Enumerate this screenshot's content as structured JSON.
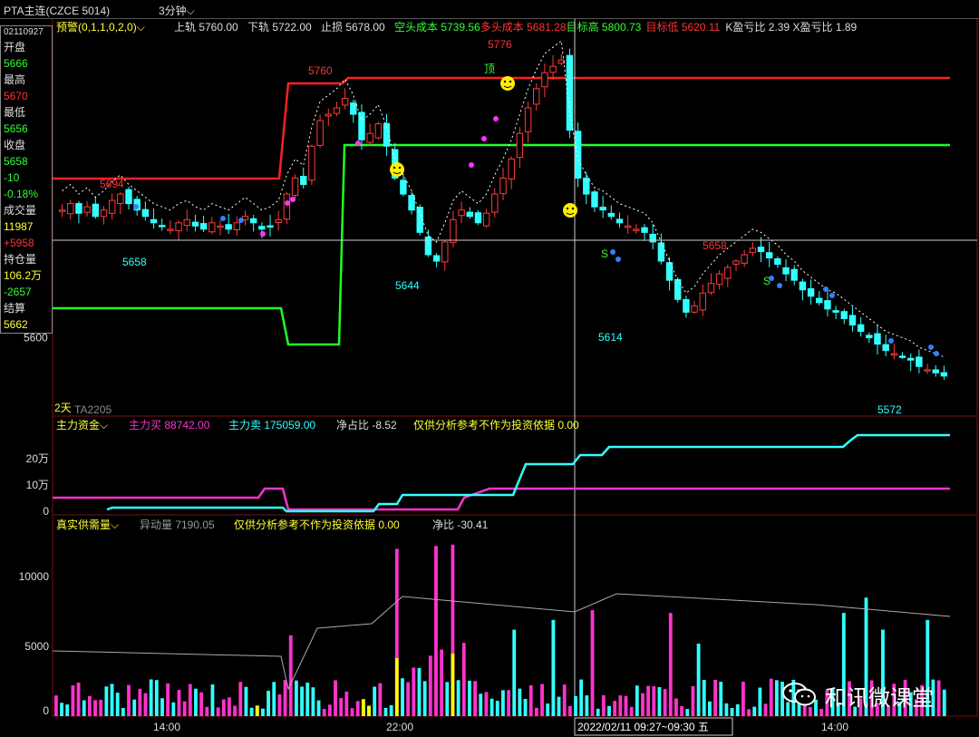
{
  "topbar": {
    "title": "PTA主连(CZCE 5014)",
    "period": "3分钟⌵"
  },
  "indicator_header": {
    "name": "预警(0,1,1,0,2,0)⌵",
    "items": [
      {
        "label": "上轨",
        "value": "5760.00",
        "color": "#dddddd"
      },
      {
        "label": "下轨",
        "value": "5722.00",
        "color": "#dddddd"
      },
      {
        "label": "止损",
        "value": "5678.00",
        "color": "#dddddd"
      },
      {
        "label": "空头成本",
        "value": "5739.56",
        "color": "#33ff33"
      },
      {
        "label": "多头成本",
        "value": "5681.28",
        "color": "#ff3333"
      },
      {
        "label": "目标高",
        "value": "5800.73",
        "color": "#33ff33"
      },
      {
        "label": "目标低",
        "value": "5620.11",
        "color": "#ff3333"
      },
      {
        "label": "K盈亏比",
        "value": "2.39",
        "color": "#dddddd"
      },
      {
        "label": "X盈亏比",
        "value": "1.89",
        "color": "#dddddd"
      }
    ]
  },
  "info_panel": {
    "date": "02110927",
    "open_label": "开盘",
    "open": "5666",
    "high_label": "最高",
    "high": "5670",
    "low_label": "最低",
    "low": "5656",
    "close_label": "收盘",
    "close": "5658",
    "change": "-10",
    "change_pct": "-0.18%",
    "volume_label": "成交量",
    "volume": "11987",
    "volume_change": "+5958",
    "oi_label": "持仓量",
    "oi": "106.2万",
    "oi_change": "-2657",
    "settle_label": "结算",
    "settle": "5662"
  },
  "main_annotations": {
    "range_label": "2天",
    "contract": "TA2205",
    "peak_labels": [
      "5694",
      "5760",
      "5776",
      "5658"
    ],
    "trough_labels": [
      "5658",
      "5644",
      "5614",
      "5572"
    ],
    "top_marker": "顶",
    "s_marker": "S"
  },
  "capital_header": {
    "name": "主力资金⌵",
    "buy_label": "主力买",
    "buy": "88742.00",
    "sell_label": "主力卖",
    "sell": "175059.00",
    "net_label": "净占比",
    "net": "-8.52",
    "note": "仅供分析参考不作为投资依据",
    "note_value": "0.00"
  },
  "volume_header": {
    "name": "真实供需量⌵",
    "abnormal_label": "异动量",
    "abnormal": "7190.05",
    "note": "仅供分析参考不作为投资依据",
    "note_value": "0.00",
    "net_label": "净比",
    "net": "-30.41"
  },
  "crosshair_label": "2022/02/11 09:27~09:30 五",
  "watermark": "和讯微课堂",
  "chart_data": [
    {
      "type": "candlestick",
      "y_tick_labels": [
        "5600"
      ],
      "lines": {
        "upper_red_level": 5760,
        "lower_green_level": 5722
      },
      "series_price_approx": [
        5680,
        5684,
        5678,
        5682,
        5676,
        5680,
        5686,
        5690,
        5684,
        5680,
        5676,
        5672,
        5670,
        5668,
        5672,
        5674,
        5670,
        5668,
        5672,
        5670,
        5668,
        5672,
        5676,
        5672,
        5668,
        5670,
        5674,
        5690,
        5700,
        5696,
        5720,
        5736,
        5740,
        5744,
        5750,
        5740,
        5724,
        5728,
        5734,
        5720,
        5700,
        5690,
        5680,
        5666,
        5652,
        5648,
        5660,
        5674,
        5680,
        5676,
        5672,
        5678,
        5690,
        5700,
        5712,
        5728,
        5744,
        5756,
        5766,
        5770,
        5774,
        5730,
        5700,
        5690,
        5682,
        5680,
        5676,
        5672,
        5670,
        5668,
        5666,
        5660,
        5648,
        5636,
        5624,
        5616,
        5620,
        5628,
        5634,
        5640,
        5644,
        5648,
        5652,
        5656,
        5654,
        5650,
        5646,
        5640,
        5636,
        5630,
        5626,
        5622,
        5618,
        5616,
        5612,
        5608,
        5604,
        5600,
        5596,
        5592,
        5590,
        5588,
        5586,
        5582,
        5580,
        5578,
        5576
      ]
    },
    {
      "type": "line",
      "y_tick_labels": [
        "20万",
        "10万",
        "0"
      ],
      "series": [
        {
          "name": "主力买",
          "color": "#ff33cc"
        },
        {
          "name": "主力卖",
          "color": "#33ffff"
        }
      ]
    },
    {
      "type": "bar",
      "y_tick_labels": [
        "10000",
        "5000",
        "0"
      ],
      "x_tick_labels": [
        "14:00",
        "22:00",
        "14:00"
      ],
      "ylim": [
        0,
        13000
      ]
    }
  ]
}
